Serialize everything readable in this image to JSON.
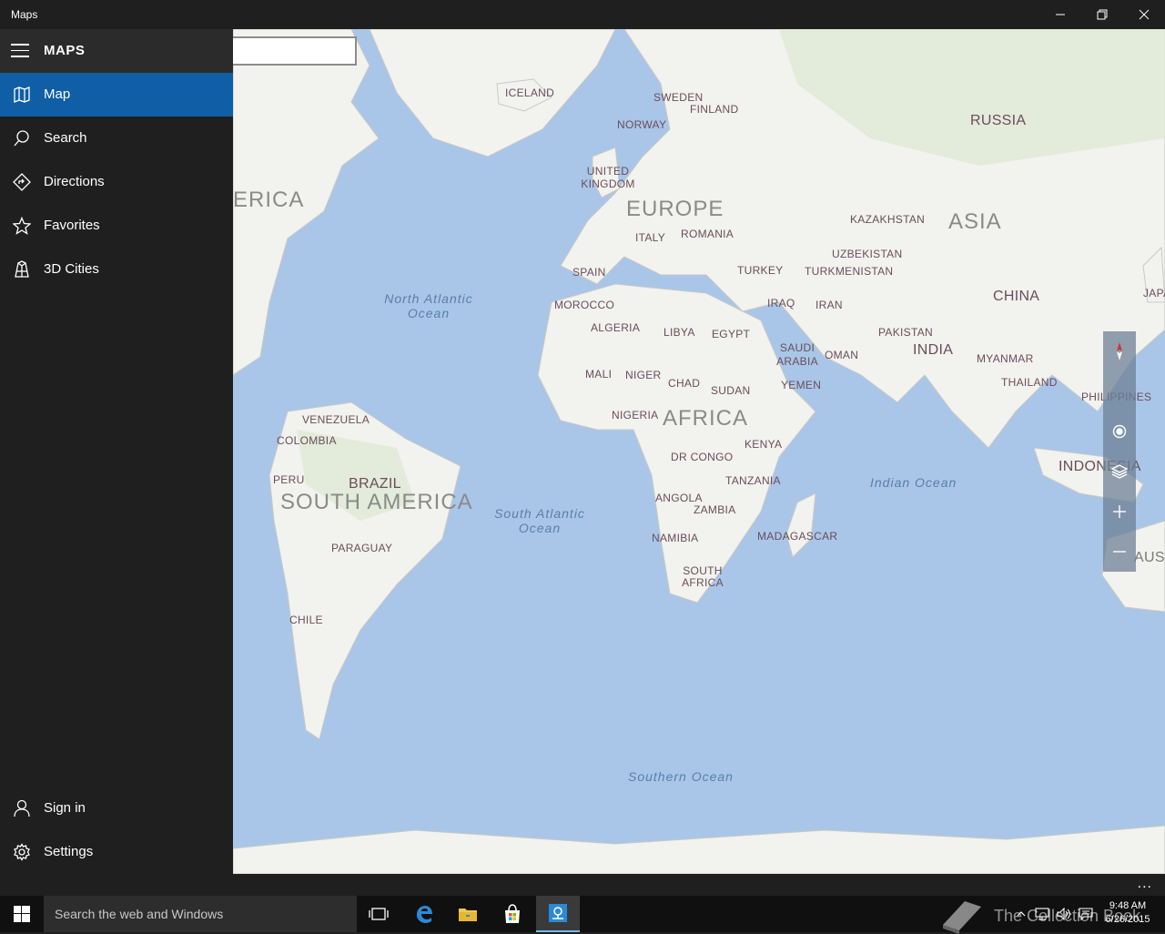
{
  "window": {
    "title": "Maps"
  },
  "sidebar": {
    "title": "MAPS",
    "nav": [
      {
        "label": "Map",
        "icon": "map-icon",
        "active": true
      },
      {
        "label": "Search",
        "icon": "search-icon",
        "active": false
      },
      {
        "label": "Directions",
        "icon": "directions-icon",
        "active": false
      },
      {
        "label": "Favorites",
        "icon": "star-icon",
        "active": false
      },
      {
        "label": "3D Cities",
        "icon": "3d-cities-icon",
        "active": false
      }
    ],
    "footer": [
      {
        "label": "Sign in",
        "icon": "person-icon"
      },
      {
        "label": "Settings",
        "icon": "gear-icon"
      }
    ]
  },
  "map": {
    "search_value": "",
    "continents": [
      "EUROPE",
      "ASIA",
      "AFRICA",
      "SOUTH AMERICA",
      "ERICA",
      "AUSTR"
    ],
    "oceans": [
      "North Atlantic Ocean",
      "South Atlantic Ocean",
      "Indian Ocean",
      "Southern Ocean"
    ],
    "countries": [
      "ICELAND",
      "SWEDEN",
      "FINLAND",
      "NORWAY",
      "UNITED KINGDOM",
      "RUSSIA",
      "KAZAKHSTAN",
      "ITALY",
      "ROMANIA",
      "SPAIN",
      "TURKEY",
      "UZBEKISTAN",
      "TURKMENISTAN",
      "MOROCCO",
      "IRAQ",
      "IRAN",
      "CHINA",
      "JAPA",
      "ALGERIA",
      "LIBYA",
      "EGYPT",
      "SAUDI ARABIA",
      "OMAN",
      "PAKISTAN",
      "INDIA",
      "MYANMAR",
      "THAILAND",
      "PHILIPPINES",
      "MALI",
      "NIGER",
      "CHAD",
      "SUDAN",
      "YEMEN",
      "NIGERIA",
      "KENYA",
      "INDONESIA",
      "VENEZUELA",
      "COLOMBIA",
      "PERU",
      "BRAZIL",
      "DR CONGO",
      "TANZANIA",
      "ANGOLA",
      "ZAMBIA",
      "NAMIBIA",
      "MADAGASCAR",
      "SOUTH AFRICA",
      "PARAGUAY",
      "CHILE"
    ],
    "controls": [
      "compass-icon",
      "location-icon",
      "layers-icon",
      "zoom-in-icon",
      "zoom-out-icon"
    ]
  },
  "appbar": {
    "more": "..."
  },
  "taskbar": {
    "search_placeholder": "Search the web and Windows",
    "watermark": "The Collection Book",
    "time": "9:48 AM",
    "date": "6/26/2015"
  },
  "colors": {
    "accent": "#0f5ea6",
    "sidebar_bg": "#1f1f1f",
    "ocean": "#a9c6e8",
    "land": "#f2f2ef"
  }
}
